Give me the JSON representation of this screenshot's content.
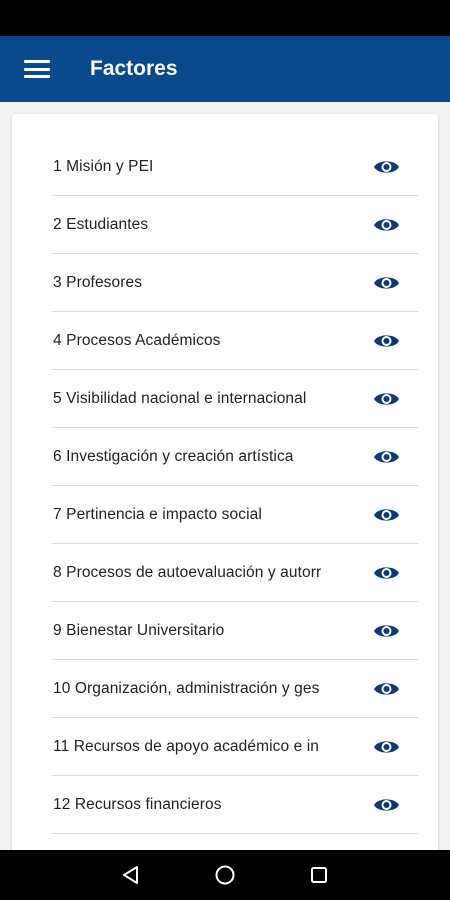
{
  "app_bar": {
    "title": "Factores",
    "menu_icon": "hamburger-menu-icon",
    "background": "#0a4a8c"
  },
  "list": {
    "items": [
      {
        "label": "1 Misión y PEI",
        "icon": "eye-icon"
      },
      {
        "label": "2 Estudiantes",
        "icon": "eye-icon"
      },
      {
        "label": "3 Profesores",
        "icon": "eye-icon"
      },
      {
        "label": "4 Procesos Académicos",
        "icon": "eye-icon"
      },
      {
        "label": "5 Visibilidad nacional e internacional",
        "icon": "eye-icon"
      },
      {
        "label": "6 Investigación y creación artística",
        "icon": "eye-icon"
      },
      {
        "label": "7 Pertinencia e impacto social",
        "icon": "eye-icon"
      },
      {
        "label": "8 Procesos de autoevaluación y autorr",
        "icon": "eye-icon"
      },
      {
        "label": "9 Bienestar Universitario",
        "icon": "eye-icon"
      },
      {
        "label": "10 Organización, administración y ges",
        "icon": "eye-icon"
      },
      {
        "label": "11 Recursos de apoyo académico e in",
        "icon": "eye-icon"
      },
      {
        "label": "12 Recursos financieros",
        "icon": "eye-icon"
      }
    ],
    "icon_color": "#0a3a78"
  },
  "nav_bar": {
    "back_icon": "back-triangle-icon",
    "home_icon": "home-circle-icon",
    "recents_icon": "recents-square-icon"
  }
}
